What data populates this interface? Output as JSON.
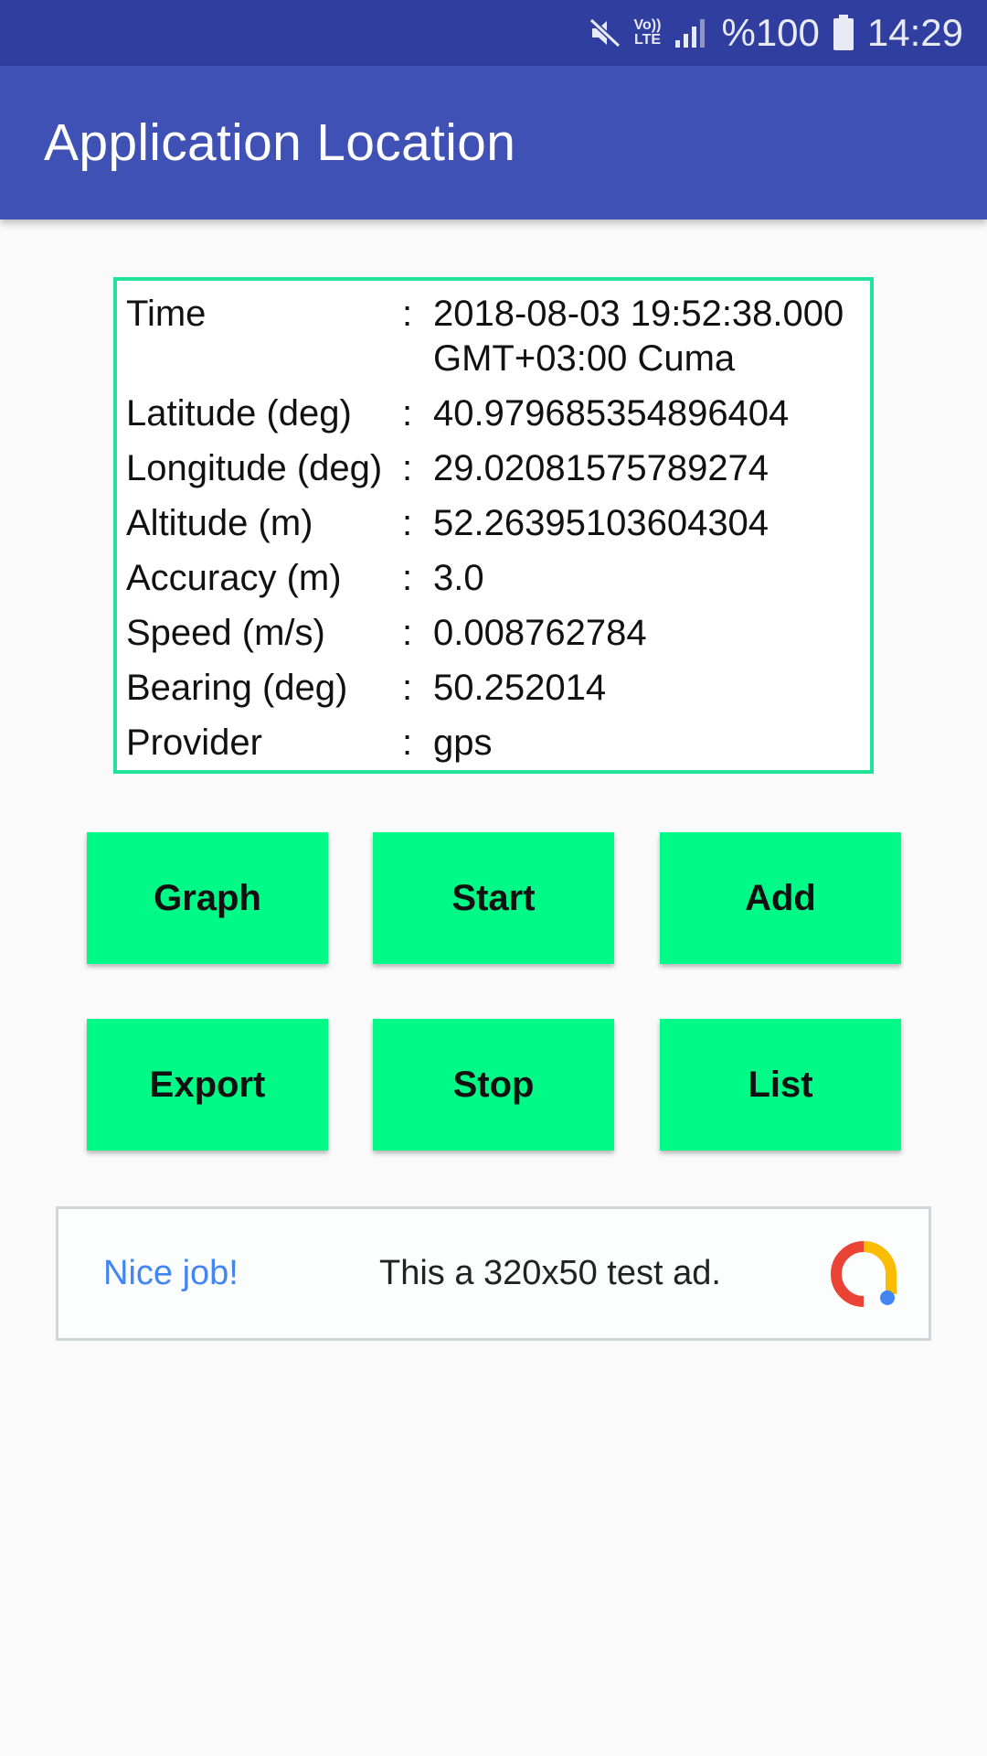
{
  "status_bar": {
    "volte_top": "Vo))",
    "volte_bottom": "LTE",
    "battery": "%100",
    "time": "14:29",
    "icons": [
      "mute-icon",
      "volte-icon",
      "signal-icon",
      "battery-icon"
    ]
  },
  "app_bar": {
    "title": "Application Location",
    "color": "#3f51b5"
  },
  "info": {
    "rows": [
      {
        "label": "Time",
        "value": "2018-08-03 19:52:38.000",
        "value2": "GMT+03:00 Cuma"
      },
      {
        "label": "Latitude (deg)",
        "value": "40.979685354896404"
      },
      {
        "label": "Longitude (deg)",
        "value": "29.02081575789274"
      },
      {
        "label": "Altitude (m)",
        "value": "52.26395103604304"
      },
      {
        "label": "Accuracy (m)",
        "value": "3.0"
      },
      {
        "label": "Speed (m/s)",
        "value": "0.008762784"
      },
      {
        "label": "Bearing (deg)",
        "value": "50.252014"
      },
      {
        "label": "Provider",
        "value": "gps"
      }
    ],
    "separator": ":",
    "border_color": "#22e39a"
  },
  "buttons": {
    "graph": "Graph",
    "start": "Start",
    "add": "Add",
    "export": "Export",
    "stop": "Stop",
    "list": "List",
    "color": "#00fa88"
  },
  "ad": {
    "headline": "Nice job!",
    "text": "This a 320x50 test ad.",
    "logo_icon": "ad-logo-icon"
  }
}
